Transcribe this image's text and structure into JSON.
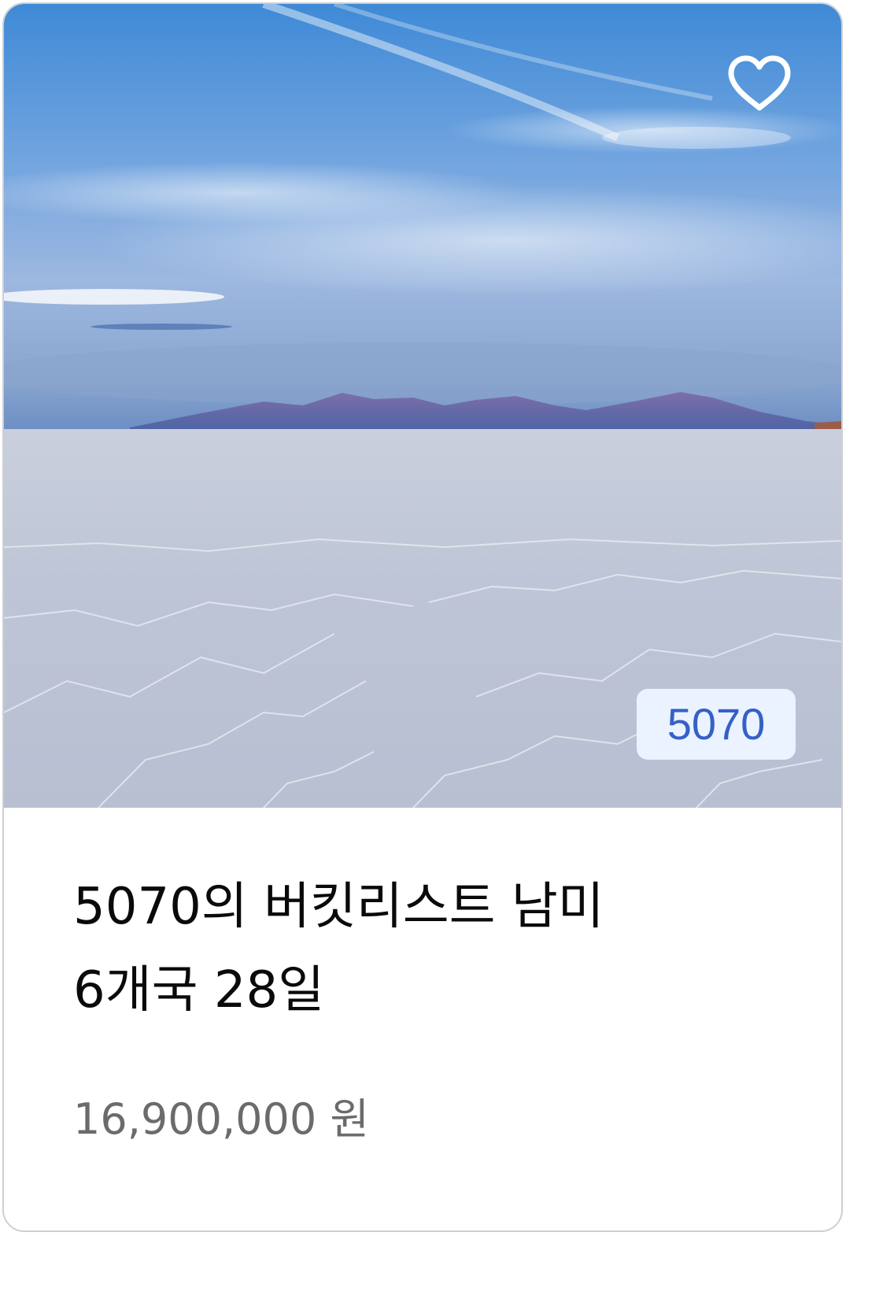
{
  "card": {
    "image_alt": "salt flat landscape",
    "favorite_icon": "heart-outline-icon",
    "badge": "5070",
    "title_line1": "5070의 버킷리스트 남미",
    "title_line2": "6개국 28일",
    "price": "16,900,000 원"
  },
  "colors": {
    "badge_bg": "#eaf3ff",
    "badge_text": "#3560c8",
    "title": "#0a0a0a",
    "price": "#6b6b6b",
    "border": "#cfcfcf"
  }
}
